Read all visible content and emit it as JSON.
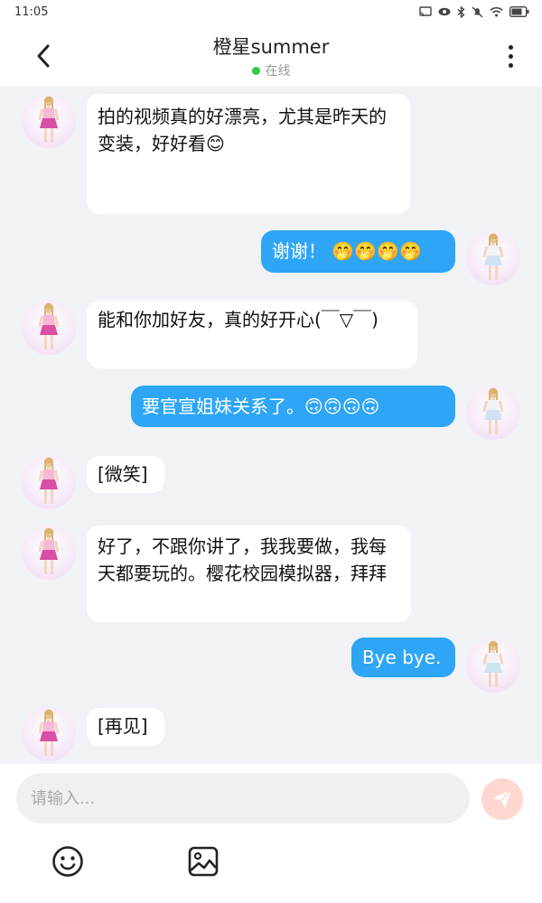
{
  "status_bar": {
    "time": "11:05",
    "icons": [
      "cast-icon",
      "eye-icon",
      "bluetooth-icon",
      "mute-icon",
      "wifi-icon",
      "battery-icon"
    ]
  },
  "header": {
    "title": "橙星summer",
    "status": "在线",
    "status_color": "#2ecc40"
  },
  "messages": [
    {
      "from": "them",
      "text": "拍的视频真的好漂亮，尤其是昨天的变装，好好看😊"
    },
    {
      "from": "me",
      "text": "谢谢！ 🤭🤭🤭🤭"
    },
    {
      "from": "them",
      "text": "能和你加好友，真的好开心(￣▽￣)"
    },
    {
      "from": "me",
      "text": "要官宣姐妹关系了。🙃🙃🙃🙃"
    },
    {
      "from": "them",
      "text": "[微笑]"
    },
    {
      "from": "them",
      "text": "好了，不跟你讲了，我我要做，我每天都要玩的。樱花校园模拟器，拜拜"
    },
    {
      "from": "me",
      "text": "Bye bye."
    },
    {
      "from": "them",
      "text": "[再见]"
    }
  ],
  "input": {
    "placeholder": "请输入..."
  },
  "colors": {
    "outgoing_bubble": "#2ea6f5",
    "incoming_bubble": "#ffffff",
    "chat_background": "#f1f2f6",
    "send_button": "#ffd6d0"
  }
}
